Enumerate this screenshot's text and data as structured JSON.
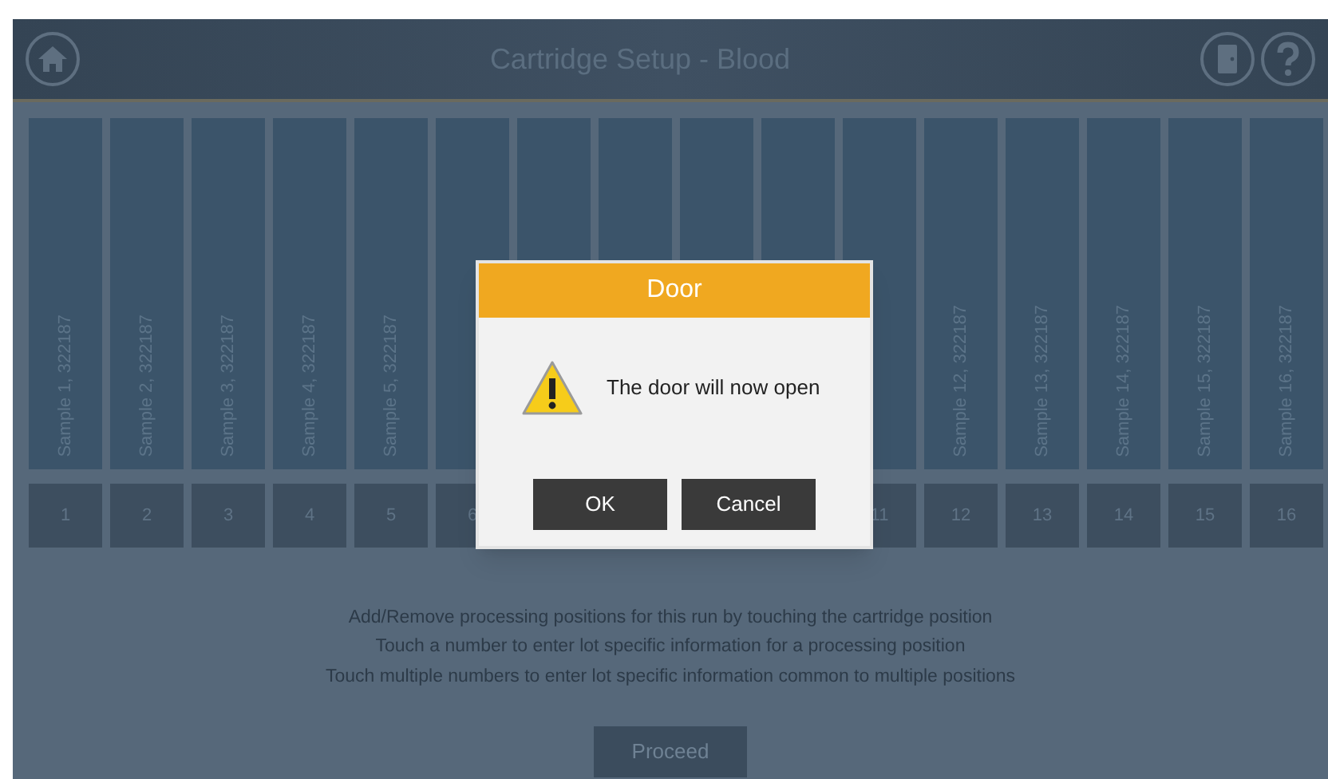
{
  "header": {
    "title": "Cartridge Setup - Blood"
  },
  "positions_left": [
    {
      "label": "Sample 1, 322187",
      "number": "1"
    },
    {
      "label": "Sample 2, 322187",
      "number": "2"
    },
    {
      "label": "Sample 3, 322187",
      "number": "3"
    },
    {
      "label": "Sample 4, 322187",
      "number": "4"
    },
    {
      "label": "Sample 5, 322187",
      "number": "5"
    },
    {
      "number": "6"
    }
  ],
  "positions_right": [
    {
      "number": "11"
    },
    {
      "label": "Sample 12, 322187",
      "number": "12"
    },
    {
      "label": "Sample 13, 322187",
      "number": "13"
    },
    {
      "label": "Sample 14, 322187",
      "number": "14"
    },
    {
      "label": "Sample 15, 322187",
      "number": "15"
    },
    {
      "label": "Sample 16, 322187",
      "number": "16"
    }
  ],
  "instructions": [
    "Add/Remove processing positions for this run by touching the cartridge position",
    "Touch a number to enter lot specific information for a processing position",
    "Touch multiple numbers to enter lot specific information common to multiple positions"
  ],
  "proceed_button": "Proceed",
  "dialog": {
    "title": "Door",
    "message": "The door will now open",
    "buttons": [
      "OK",
      "Cancel"
    ]
  }
}
